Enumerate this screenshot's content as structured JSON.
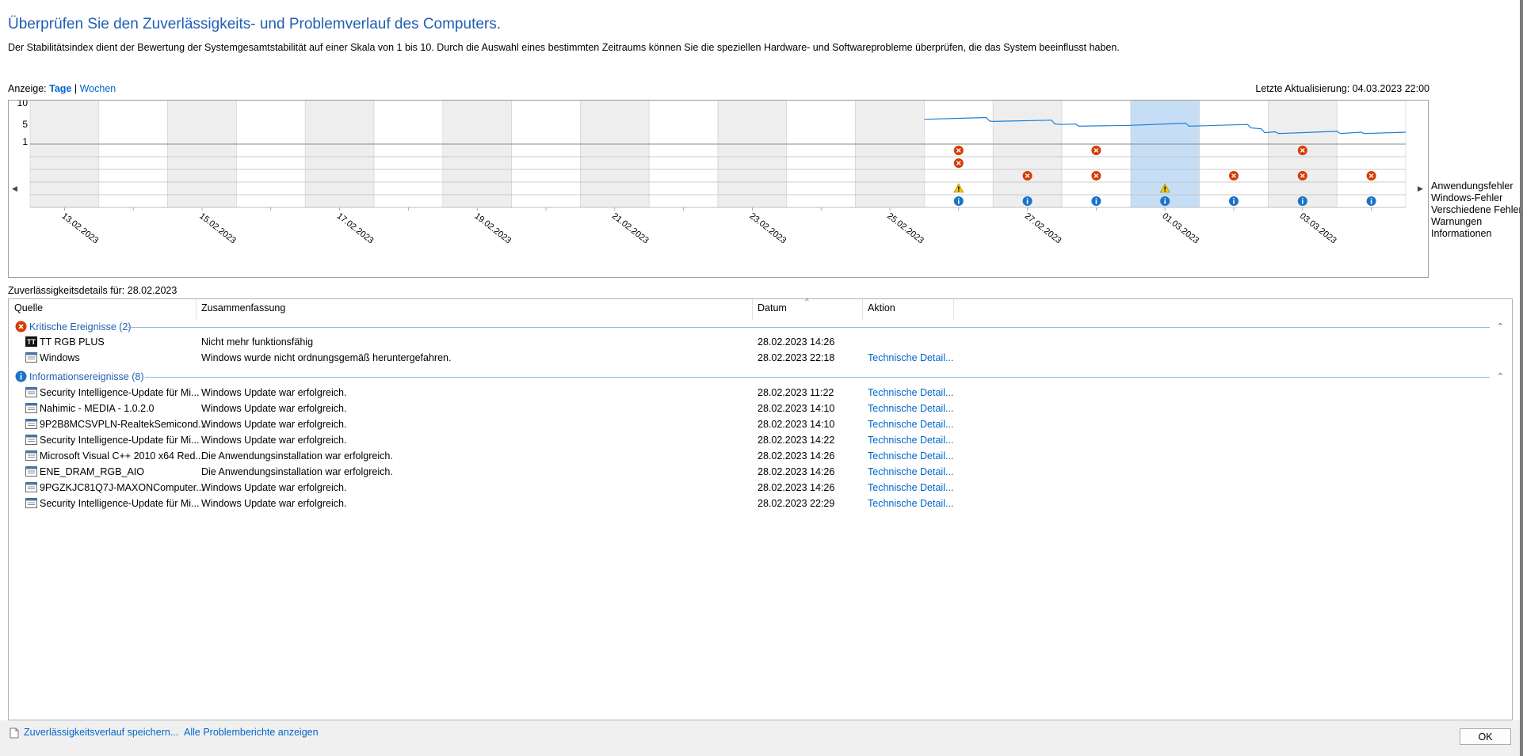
{
  "header": {
    "title": "Überprüfen Sie den Zuverlässigkeits- und Problemverlauf des Computers.",
    "description": "Der Stabilitätsindex dient der Bewertung der Systemgesamtstabilität auf einer Skala von 1 bis 10. Durch die Auswahl eines bestimmten Zeitraums können Sie die speziellen Hardware- und Softwareprobleme überprüfen, die das System beeinflusst haben."
  },
  "view": {
    "label": "Anzeige:",
    "days": "Tage",
    "sep": "|",
    "weeks": "Wochen",
    "last_update": "Letzte Aktualisierung: 04.03.2023 22:00"
  },
  "chart_data": {
    "type": "line",
    "y_ticks": [
      "10",
      "5",
      "1"
    ],
    "ylim": [
      1,
      10
    ],
    "x_labels": [
      "13.02.2023",
      "15.02.2023",
      "17.02.2023",
      "19.02.2023",
      "21.02.2023",
      "23.02.2023",
      "25.02.2023",
      "27.02.2023",
      "01.03.2023",
      "03.03.2023"
    ],
    "days": [
      "12.02",
      "13.02",
      "14.02",
      "15.02",
      "16.02",
      "17.02",
      "18.02",
      "19.02",
      "20.02",
      "21.02",
      "22.02",
      "23.02",
      "24.02",
      "25.02",
      "26.02",
      "27.02",
      "28.02",
      "01.03",
      "02.03",
      "03.03"
    ],
    "selected_day": "28.02",
    "stability_index": [
      [
        13.0,
        6.2
      ],
      [
        13.9,
        6.6
      ],
      [
        13.95,
        5.8
      ],
      [
        14.0,
        5.7
      ],
      [
        14.85,
        6.0
      ],
      [
        14.9,
        5.1
      ],
      [
        15.0,
        5.0
      ],
      [
        15.2,
        5.1
      ],
      [
        15.25,
        4.6
      ],
      [
        16.0,
        4.8
      ],
      [
        16.8,
        5.3
      ],
      [
        16.85,
        4.6
      ],
      [
        17.7,
        5.0
      ],
      [
        17.75,
        4.2
      ],
      [
        17.9,
        4.0
      ],
      [
        17.95,
        3.1
      ],
      [
        18.1,
        3.3
      ],
      [
        18.15,
        2.9
      ],
      [
        19.0,
        3.4
      ],
      [
        19.05,
        2.9
      ],
      [
        19.35,
        3.2
      ],
      [
        19.4,
        2.9
      ],
      [
        20.0,
        3.2
      ]
    ],
    "event_rows": [
      "Anwendungsfehler",
      "Windows-Fehler",
      "Verschiedene Fehler",
      "Warnungen",
      "Informationen"
    ],
    "events": {
      "Anwendungsfehler": [
        13,
        15,
        18
      ],
      "Windows-Fehler": [
        13
      ],
      "Verschiedene Fehler": [
        14,
        15,
        17,
        18,
        19
      ],
      "Warnungen": [
        13,
        16
      ],
      "Informationen": [
        13,
        14,
        15,
        16,
        17,
        18,
        19
      ]
    }
  },
  "details": {
    "label": "Zuverlässigkeitsdetails für: 28.02.2023",
    "columns": [
      "Quelle",
      "Zusammenfassung",
      "Datum",
      "Aktion"
    ],
    "groups": [
      {
        "label": "Kritische Ereignisse (2)",
        "icon": "error-icon",
        "rows": [
          {
            "source": "TT RGB PLUS",
            "summary": "Nicht mehr funktionsfähig",
            "date": "28.02.2023 14:26",
            "action": "",
            "icon": "tt-app-icon"
          },
          {
            "source": "Windows",
            "summary": "Windows wurde nicht ordnungsgemäß heruntergefahren.",
            "date": "28.02.2023 22:18",
            "action": "Technische Detail...",
            "icon": "window-icon"
          }
        ]
      },
      {
        "label": "Informationsereignisse (8)",
        "icon": "info-icon",
        "rows": [
          {
            "source": "Security Intelligence-Update für Mi...",
            "summary": "Windows Update war erfolgreich.",
            "date": "28.02.2023 11:22",
            "action": "Technische Detail...",
            "icon": "window-icon"
          },
          {
            "source": "Nahimic - MEDIA - 1.0.2.0",
            "summary": "Windows Update war erfolgreich.",
            "date": "28.02.2023 14:10",
            "action": "Technische Detail...",
            "icon": "window-icon"
          },
          {
            "source": "9P2B8MCSVPLN-RealtekSemicond...",
            "summary": "Windows Update war erfolgreich.",
            "date": "28.02.2023 14:10",
            "action": "Technische Detail...",
            "icon": "window-icon"
          },
          {
            "source": "Security Intelligence-Update für Mi...",
            "summary": "Windows Update war erfolgreich.",
            "date": "28.02.2023 14:22",
            "action": "Technische Detail...",
            "icon": "window-icon"
          },
          {
            "source": "Microsoft Visual C++ 2010  x64 Red...",
            "summary": "Die Anwendungsinstallation war erfolgreich.",
            "date": "28.02.2023 14:26",
            "action": "Technische Detail...",
            "icon": "window-icon"
          },
          {
            "source": "ENE_DRAM_RGB_AIO",
            "summary": "Die Anwendungsinstallation war erfolgreich.",
            "date": "28.02.2023 14:26",
            "action": "Technische Detail...",
            "icon": "window-icon"
          },
          {
            "source": "9PGZKJC81Q7J-MAXONComputer...",
            "summary": "Windows Update war erfolgreich.",
            "date": "28.02.2023 14:26",
            "action": "Technische Detail...",
            "icon": "window-icon"
          },
          {
            "source": "Security Intelligence-Update für Mi...",
            "summary": "Windows Update war erfolgreich.",
            "date": "28.02.2023 22:29",
            "action": "Technische Detail...",
            "icon": "window-icon"
          }
        ]
      }
    ]
  },
  "footer": {
    "save_link": "Zuverlässigkeitsverlauf speichern...",
    "all_reports_link": "Alle Problemberichte anzeigen",
    "ok_label": "OK"
  },
  "colors": {
    "title": "#1e5fb3",
    "link": "#0066cc",
    "line": "#1f7fd4",
    "selected_col": "#c6def5",
    "shaded_col": "#eeeeee",
    "error": "#d83b01",
    "warning": "#f2c811",
    "info": "#1a73c9"
  }
}
